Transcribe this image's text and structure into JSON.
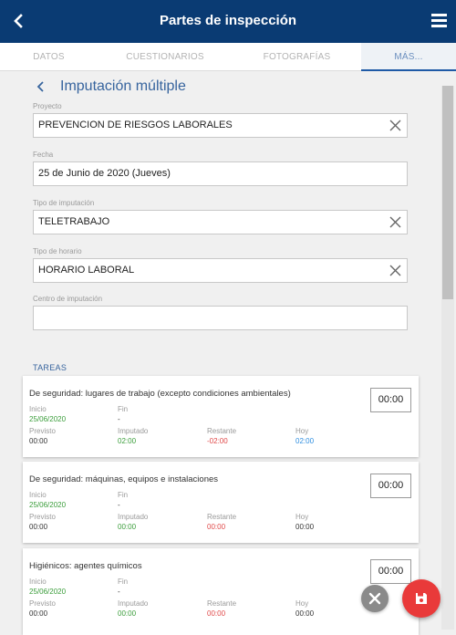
{
  "app": {
    "title": "Partes de inspección",
    "back_icon": "back-arrow-icon",
    "menu_icon": "hamburger-menu-icon"
  },
  "tabs": [
    {
      "label": "DATOS"
    },
    {
      "label": "CUESTIONARIOS"
    },
    {
      "label": "FOTOGRAFÍAS"
    },
    {
      "label": "MÁS..."
    }
  ],
  "active_tab": "MÁS...",
  "subheader": {
    "title": "Imputación múltiple"
  },
  "form": {
    "proyecto": {
      "label": "Proyecto",
      "value": "PREVENCION DE RIESGOS LABORALES"
    },
    "fecha": {
      "label": "Fecha",
      "value": "25 de Junio de 2020 (Jueves)"
    },
    "tipo_imputacion": {
      "label": "Tipo de imputación",
      "value": "TELETRABAJO"
    },
    "tipo_horario": {
      "label": "Tipo de horario",
      "value": "HORARIO LABORAL"
    },
    "centro": {
      "label": "Centro de imputación",
      "value": ""
    }
  },
  "section": {
    "title": "TAREAS"
  },
  "labels": {
    "inicio": "Inicio",
    "fin": "Fin",
    "previsto": "Previsto",
    "imputado": "Imputado",
    "restante": "Restante",
    "hoy": "Hoy"
  },
  "tasks": [
    {
      "title": "De seguridad: lugares de trabajo (excepto condiciones ambientales)",
      "time": "00:00",
      "inicio": "25/06/2020",
      "fin": "-",
      "previsto": "00:00",
      "imputado": "02:00",
      "restante": "-02:00",
      "hoy": "02:00"
    },
    {
      "title": "De seguridad: máquinas, equipos e instalaciones",
      "time": "00:00",
      "inicio": "25/06/2020",
      "fin": "-",
      "previsto": "00:00",
      "imputado": "00:00",
      "restante": "00:00",
      "hoy": "00:00"
    },
    {
      "title": "Higiénicos: agentes químicos",
      "time": "00:00",
      "inicio": "25/06/2020",
      "fin": "-",
      "previsto": "00:00",
      "imputado": "00:00",
      "restante": "00:00",
      "hoy": "00:00"
    }
  ],
  "colors": {
    "appbar": "#0a3b73",
    "accent": "#37649e",
    "green": "#3a9d3a",
    "red": "#e04848",
    "blue": "#2e8ee0",
    "save_fab": "#e93a3a",
    "cancel_fab": "#8a8a8a"
  }
}
